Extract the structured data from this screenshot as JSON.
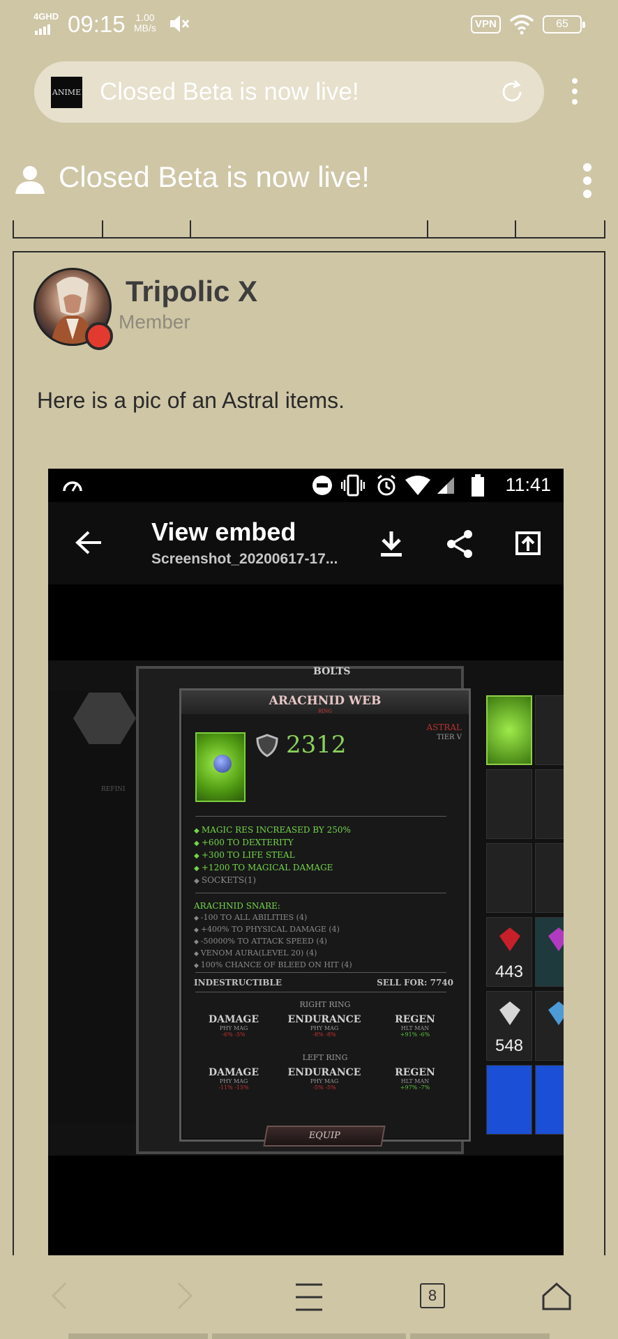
{
  "status_bar": {
    "network": "4GHD",
    "time": "09:15",
    "speed_value": "1.00",
    "speed_unit": "MB/s",
    "vpn": "VPN",
    "battery": "65"
  },
  "browser": {
    "favicon_text": "ANIME",
    "url_text": "Closed Beta is now live!"
  },
  "page": {
    "title": "Closed Beta is now live!"
  },
  "post": {
    "author": "Tripolic X",
    "role": "Member",
    "body": "Here is a pic of an Astral items."
  },
  "embed": {
    "status_time": "11:41",
    "title": "View embed",
    "subtitle": "Screenshot_20200617-17...",
    "game": {
      "bolts_label": "BOLTS",
      "refine_label": "REFINI",
      "item_name": "ARACHNID WEB",
      "item_type": "RING",
      "score": "2312",
      "rarity": "ASTRAL",
      "tier": "TIER V",
      "stats": [
        "MAGIC RES INCREASED BY 250%",
        "+600 TO DEXTERITY",
        "+300 TO LIFE STEAL",
        "+1200 TO MAGICAL DAMAGE"
      ],
      "sockets": "SOCKETS(1)",
      "snare_heading": "ARACHNID SNARE:",
      "snare": [
        "-100 TO ALL ABILITIES (4)",
        "+400% TO PHYSICAL DAMAGE (4)",
        "-50000% TO ATTACK SPEED (4)",
        "VENOM AURA(LEVEL 20) (4)",
        "100% CHANCE OF BLEED ON HIT (4)"
      ],
      "indestructible": "INDESTRUCTIBLE",
      "sell_for": "SELL FOR: 7740",
      "right_ring": "RIGHT RING",
      "left_ring": "LEFT RING",
      "columns": [
        "DAMAGE",
        "ENDURANCE",
        "REGEN"
      ],
      "col_subs": [
        "PHY MAG",
        "PHY MAG",
        "HLT MAN"
      ],
      "right_values": [
        "-6% -5%",
        "-8% -8%",
        "+91% -6%"
      ],
      "left_values": [
        "-11% -15%",
        "-5% -5%",
        "+97% -7%"
      ],
      "equip": "EQUIP",
      "inv_counts": [
        "443",
        "548"
      ]
    }
  },
  "bottom_nav": {
    "tab_count": "8"
  },
  "colors": {
    "background": "#cfc6a6",
    "accent_red": "#e33a2f"
  }
}
